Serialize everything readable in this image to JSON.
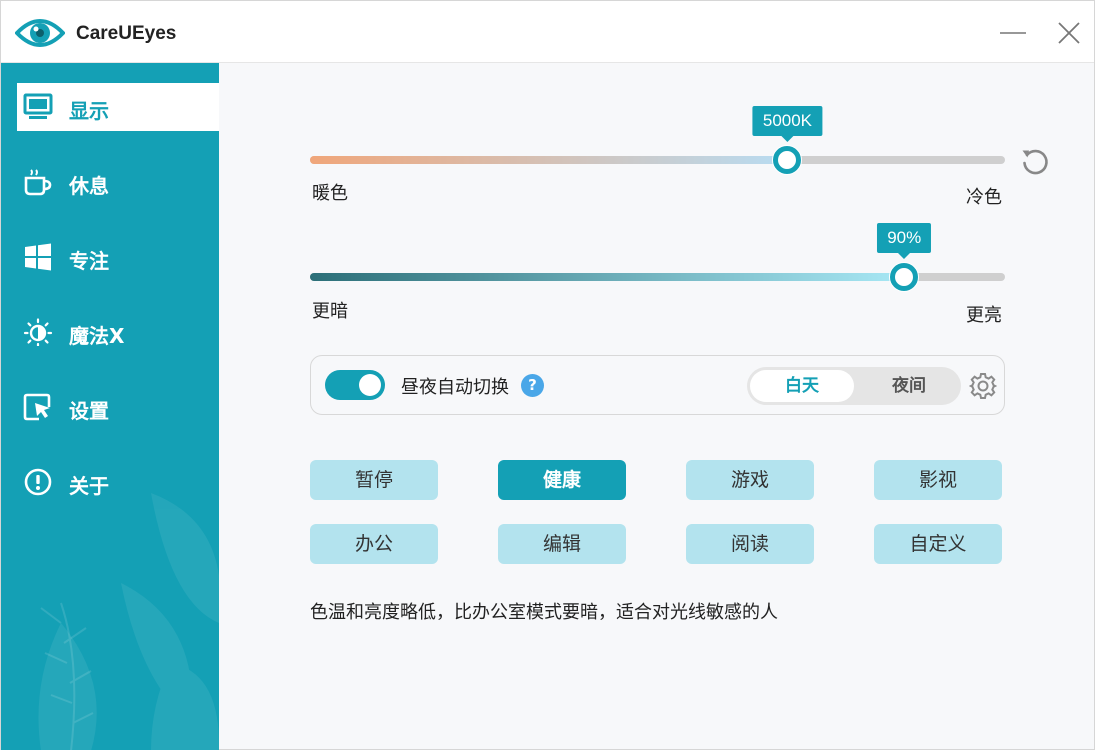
{
  "app": {
    "title": "CareUEyes"
  },
  "sidebar": {
    "items": [
      {
        "label": "显示",
        "icon": "monitor-icon",
        "active": true
      },
      {
        "label": "休息",
        "icon": "coffee-cup-icon",
        "active": false
      },
      {
        "label": "专注",
        "icon": "windows-icon",
        "active": false
      },
      {
        "label": "魔法X",
        "icon": "sun-moon-icon",
        "active": false
      },
      {
        "label": "设置",
        "icon": "cursor-window-icon",
        "active": false
      },
      {
        "label": "关于",
        "icon": "info-circle-icon",
        "active": false
      }
    ]
  },
  "color_temp": {
    "value_label": "5000K",
    "fraction": 0.687,
    "left_label": "暖色",
    "right_label": "冷色"
  },
  "brightness": {
    "value_label": "90%",
    "fraction": 0.855,
    "left_label": "更暗",
    "right_label": "更亮"
  },
  "auto_switch": {
    "label": "昼夜自动切换",
    "enabled": true,
    "help": "?",
    "day": "白天",
    "night": "夜间",
    "selected": "白天"
  },
  "modes": [
    {
      "label": "暂停",
      "active": false
    },
    {
      "label": "健康",
      "active": true
    },
    {
      "label": "游戏",
      "active": false
    },
    {
      "label": "影视",
      "active": false
    },
    {
      "label": "办公",
      "active": false
    },
    {
      "label": "编辑",
      "active": false
    },
    {
      "label": "阅读",
      "active": false
    },
    {
      "label": "自定义",
      "active": false
    }
  ],
  "description": "色温和亮度略低，比办公室模式要暗，适合对光线敏感的人",
  "colors": {
    "accent": "#14a0b5",
    "mode_button": "#b3e3ee",
    "warm": "#f0a67a",
    "cool": "#b8dcf2",
    "dark": "#2c6f78",
    "bright": "#a8e8f5",
    "help": "#4aa7e8"
  }
}
